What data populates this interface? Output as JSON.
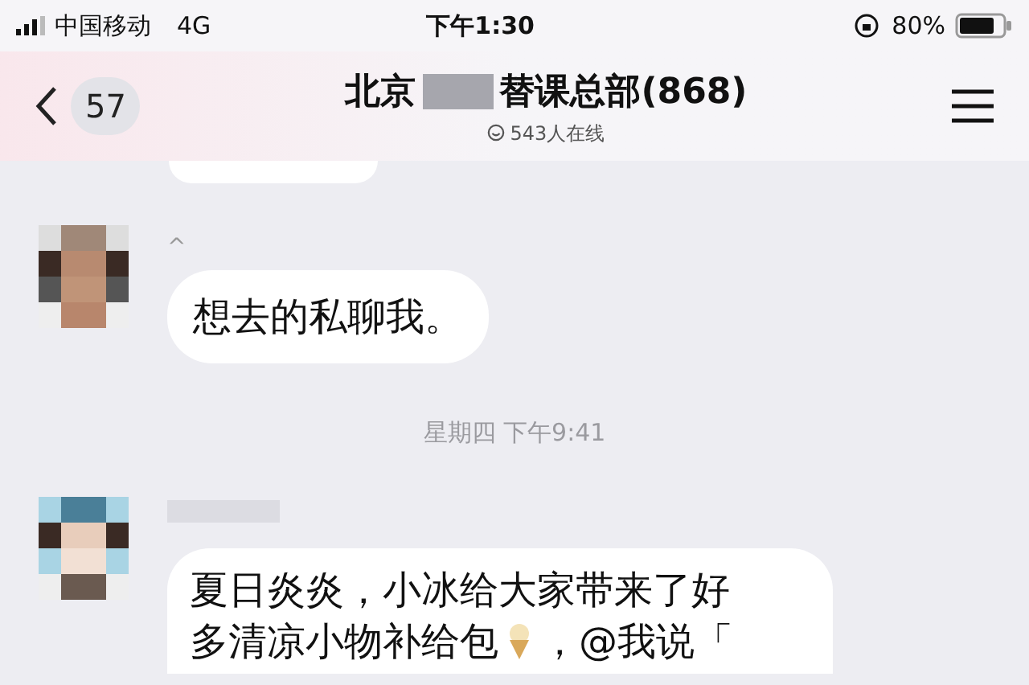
{
  "status_bar": {
    "carrier": "中国移动",
    "network": "4G",
    "time": "下午1:30",
    "battery": "80%"
  },
  "nav": {
    "back_count": "57",
    "title_start": "北京",
    "title_end": "替课总部(868)",
    "online": "543人在线"
  },
  "messages": [
    {
      "kind": "partial"
    },
    {
      "kind": "text",
      "name": "^",
      "text": "想去的私聊我。"
    },
    {
      "kind": "time",
      "text": "星期四 下午9:41"
    },
    {
      "kind": "rich",
      "line1": "夏日炎炎，小冰给大家带来了好",
      "line2_start": "多清凉小物补给包",
      "line2_end": "，@我说「"
    }
  ]
}
